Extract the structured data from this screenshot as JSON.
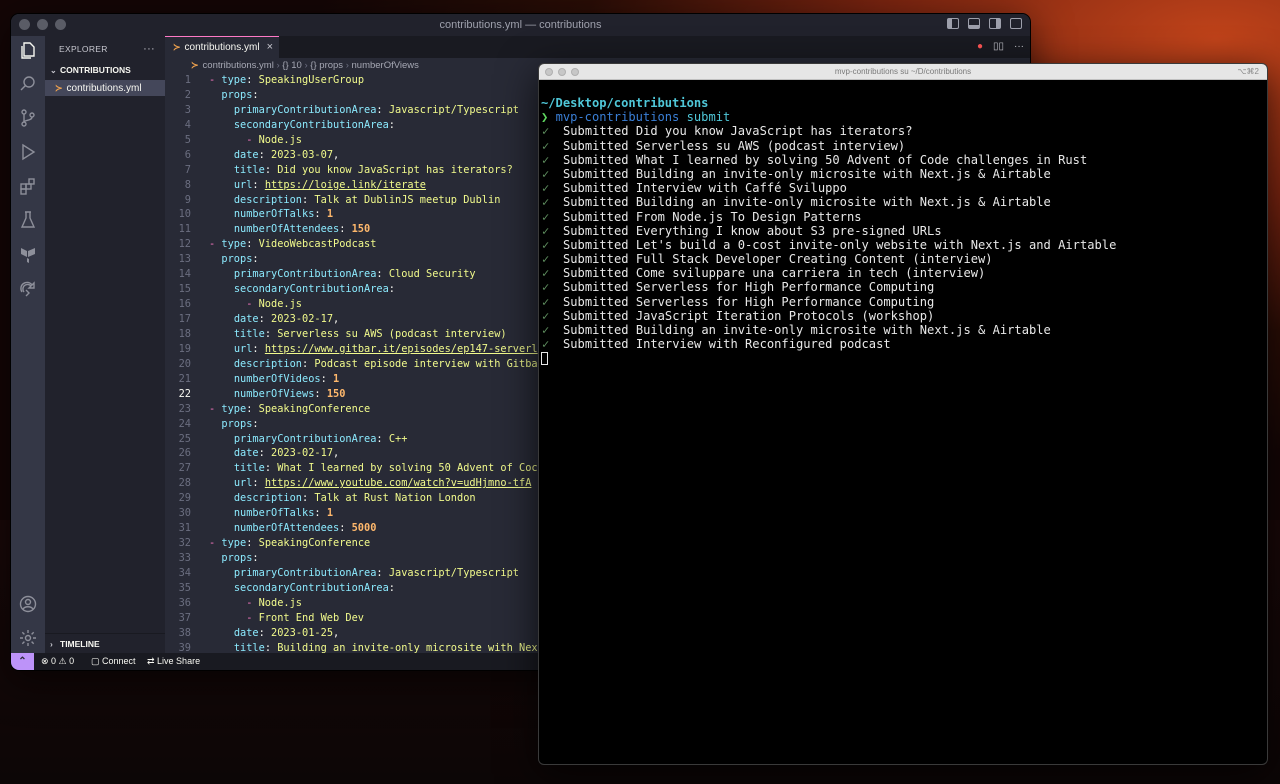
{
  "vscode": {
    "window_title": "contributions.yml — contributions",
    "sidebar": {
      "header": "EXPLORER",
      "more": "···",
      "folder": "CONTRIBUTIONS",
      "file": "contributions.yml",
      "timeline": "TIMELINE"
    },
    "tab": {
      "label": "contributions.yml",
      "close": "×"
    },
    "breadcrumb": [
      "contributions.yml",
      "{} 10",
      "{} props",
      "numberOfViews"
    ],
    "status": {
      "problems": "⊗ 0 ⚠ 0",
      "connect": "Connect",
      "live_share": "Live Share"
    },
    "activity_icons": [
      "files-icon",
      "search-icon",
      "source-control-icon",
      "run-debug-icon",
      "extensions-icon",
      "testing-icon",
      "deploy-icon",
      "remote-share-icon",
      "account-icon",
      "settings-gear-icon"
    ]
  },
  "code": [
    {
      "n": 1,
      "t": [
        [
          "p",
          "- "
        ],
        [
          "k",
          "type"
        ],
        [
          "w",
          ": "
        ],
        [
          "s",
          "SpeakingUserGroup"
        ]
      ]
    },
    {
      "n": 2,
      "t": [
        [
          "w",
          "  "
        ],
        [
          "k",
          "props"
        ],
        [
          "w",
          ":"
        ]
      ]
    },
    {
      "n": 3,
      "t": [
        [
          "w",
          "    "
        ],
        [
          "k",
          "primaryContributionArea"
        ],
        [
          "w",
          ": "
        ],
        [
          "s",
          "Javascript/Typescript"
        ]
      ]
    },
    {
      "n": 4,
      "t": [
        [
          "w",
          "    "
        ],
        [
          "k",
          "secondaryContributionArea"
        ],
        [
          "w",
          ":"
        ]
      ]
    },
    {
      "n": 5,
      "t": [
        [
          "w",
          "      "
        ],
        [
          "p",
          "- "
        ],
        [
          "s",
          "Node.js"
        ]
      ]
    },
    {
      "n": 6,
      "t": [
        [
          "w",
          "    "
        ],
        [
          "k",
          "date"
        ],
        [
          "w",
          ": "
        ],
        [
          "s",
          "2023-03-07"
        ],
        [
          "w",
          ","
        ]
      ]
    },
    {
      "n": 7,
      "t": [
        [
          "w",
          "    "
        ],
        [
          "k",
          "title"
        ],
        [
          "w",
          ": "
        ],
        [
          "s",
          "Did you know JavaScript has iterators?"
        ]
      ]
    },
    {
      "n": 8,
      "t": [
        [
          "w",
          "    "
        ],
        [
          "k",
          "url"
        ],
        [
          "w",
          ": "
        ],
        [
          "u",
          "https://loige.link/iterate"
        ]
      ]
    },
    {
      "n": 9,
      "t": [
        [
          "w",
          "    "
        ],
        [
          "k",
          "description"
        ],
        [
          "w",
          ": "
        ],
        [
          "s",
          "Talk at DublinJS meetup Dublin"
        ]
      ]
    },
    {
      "n": 10,
      "t": [
        [
          "w",
          "    "
        ],
        [
          "k",
          "numberOfTalks"
        ],
        [
          "w",
          ": "
        ],
        [
          "n",
          "1"
        ]
      ]
    },
    {
      "n": 11,
      "t": [
        [
          "w",
          "    "
        ],
        [
          "k",
          "numberOfAttendees"
        ],
        [
          "w",
          ": "
        ],
        [
          "n",
          "150"
        ]
      ]
    },
    {
      "n": 12,
      "t": [
        [
          "p",
          "- "
        ],
        [
          "k",
          "type"
        ],
        [
          "w",
          ": "
        ],
        [
          "s",
          "VideoWebcastPodcast"
        ]
      ]
    },
    {
      "n": 13,
      "t": [
        [
          "w",
          "  "
        ],
        [
          "k",
          "props"
        ],
        [
          "w",
          ":"
        ]
      ]
    },
    {
      "n": 14,
      "t": [
        [
          "w",
          "    "
        ],
        [
          "k",
          "primaryContributionArea"
        ],
        [
          "w",
          ": "
        ],
        [
          "s",
          "Cloud Security"
        ]
      ]
    },
    {
      "n": 15,
      "t": [
        [
          "w",
          "    "
        ],
        [
          "k",
          "secondaryContributionArea"
        ],
        [
          "w",
          ":"
        ]
      ]
    },
    {
      "n": 16,
      "t": [
        [
          "w",
          "      "
        ],
        [
          "p",
          "- "
        ],
        [
          "s",
          "Node.js"
        ]
      ]
    },
    {
      "n": 17,
      "t": [
        [
          "w",
          "    "
        ],
        [
          "k",
          "date"
        ],
        [
          "w",
          ": "
        ],
        [
          "s",
          "2023-02-17"
        ],
        [
          "w",
          ","
        ]
      ]
    },
    {
      "n": 18,
      "t": [
        [
          "w",
          "    "
        ],
        [
          "k",
          "title"
        ],
        [
          "w",
          ": "
        ],
        [
          "s",
          "Serverless su AWS (podcast interview)"
        ]
      ]
    },
    {
      "n": 19,
      "t": [
        [
          "w",
          "    "
        ],
        [
          "k",
          "url"
        ],
        [
          "w",
          ": "
        ],
        [
          "u",
          "https://www.gitbar.it/episodes/ep147-serverl"
        ]
      ]
    },
    {
      "n": 20,
      "t": [
        [
          "w",
          "    "
        ],
        [
          "k",
          "description"
        ],
        [
          "w",
          ": "
        ],
        [
          "s",
          "Podcast episode interview with Gitba"
        ]
      ]
    },
    {
      "n": 21,
      "t": [
        [
          "w",
          "    "
        ],
        [
          "k",
          "numberOfVideos"
        ],
        [
          "w",
          ": "
        ],
        [
          "n",
          "1"
        ]
      ]
    },
    {
      "n": 22,
      "t": [
        [
          "w",
          "    "
        ],
        [
          "k",
          "numberOfViews"
        ],
        [
          "w",
          ": "
        ],
        [
          "n",
          "150"
        ]
      ]
    },
    {
      "n": 23,
      "t": [
        [
          "p",
          "- "
        ],
        [
          "k",
          "type"
        ],
        [
          "w",
          ": "
        ],
        [
          "s",
          "SpeakingConference"
        ]
      ]
    },
    {
      "n": 24,
      "t": [
        [
          "w",
          "  "
        ],
        [
          "k",
          "props"
        ],
        [
          "w",
          ":"
        ]
      ]
    },
    {
      "n": 25,
      "t": [
        [
          "w",
          "    "
        ],
        [
          "k",
          "primaryContributionArea"
        ],
        [
          "w",
          ": "
        ],
        [
          "s",
          "C++"
        ]
      ]
    },
    {
      "n": 26,
      "t": [
        [
          "w",
          "    "
        ],
        [
          "k",
          "date"
        ],
        [
          "w",
          ": "
        ],
        [
          "s",
          "2023-02-17"
        ],
        [
          "w",
          ","
        ]
      ]
    },
    {
      "n": 27,
      "t": [
        [
          "w",
          "    "
        ],
        [
          "k",
          "title"
        ],
        [
          "w",
          ": "
        ],
        [
          "s",
          "What I learned by solving 50 Advent of Coc"
        ]
      ]
    },
    {
      "n": 28,
      "t": [
        [
          "w",
          "    "
        ],
        [
          "k",
          "url"
        ],
        [
          "w",
          ": "
        ],
        [
          "u",
          "https://www.youtube.com/watch?v=udHjmno-tfA"
        ]
      ]
    },
    {
      "n": 29,
      "t": [
        [
          "w",
          "    "
        ],
        [
          "k",
          "description"
        ],
        [
          "w",
          ": "
        ],
        [
          "s",
          "Talk at Rust Nation London"
        ]
      ]
    },
    {
      "n": 30,
      "t": [
        [
          "w",
          "    "
        ],
        [
          "k",
          "numberOfTalks"
        ],
        [
          "w",
          ": "
        ],
        [
          "n",
          "1"
        ]
      ]
    },
    {
      "n": 31,
      "t": [
        [
          "w",
          "    "
        ],
        [
          "k",
          "numberOfAttendees"
        ],
        [
          "w",
          ": "
        ],
        [
          "n",
          "5000"
        ]
      ]
    },
    {
      "n": 32,
      "t": [
        [
          "p",
          "- "
        ],
        [
          "k",
          "type"
        ],
        [
          "w",
          ": "
        ],
        [
          "s",
          "SpeakingConference"
        ]
      ]
    },
    {
      "n": 33,
      "t": [
        [
          "w",
          "  "
        ],
        [
          "k",
          "props"
        ],
        [
          "w",
          ":"
        ]
      ]
    },
    {
      "n": 34,
      "t": [
        [
          "w",
          "    "
        ],
        [
          "k",
          "primaryContributionArea"
        ],
        [
          "w",
          ": "
        ],
        [
          "s",
          "Javascript/Typescript"
        ]
      ]
    },
    {
      "n": 35,
      "t": [
        [
          "w",
          "    "
        ],
        [
          "k",
          "secondaryContributionArea"
        ],
        [
          "w",
          ":"
        ]
      ]
    },
    {
      "n": 36,
      "t": [
        [
          "w",
          "      "
        ],
        [
          "p",
          "- "
        ],
        [
          "s",
          "Node.js"
        ]
      ]
    },
    {
      "n": 37,
      "t": [
        [
          "w",
          "      "
        ],
        [
          "p",
          "- "
        ],
        [
          "s",
          "Front End Web Dev"
        ]
      ]
    },
    {
      "n": 38,
      "t": [
        [
          "w",
          "    "
        ],
        [
          "k",
          "date"
        ],
        [
          "w",
          ": "
        ],
        [
          "s",
          "2023-01-25"
        ],
        [
          "w",
          ","
        ]
      ]
    },
    {
      "n": 39,
      "t": [
        [
          "w",
          "    "
        ],
        [
          "k",
          "title"
        ],
        [
          "w",
          ": "
        ],
        [
          "s",
          "Building an invite-only microsite with Nex"
        ]
      ]
    }
  ],
  "terminal": {
    "title": "mvp-contributions su ~/D/contributions",
    "shortcut": "⌥⌘2",
    "path": "~/Desktop/contributions",
    "prompt": "❯",
    "command": "mvp-contributions",
    "argument": "submit",
    "check": "✓",
    "submitted_prefix": "Submitted",
    "submissions": [
      "Did you know JavaScript has iterators?",
      "Serverless su AWS (podcast interview)",
      "What I learned by solving 50 Advent of Code challenges in Rust",
      "Building an invite-only microsite with Next.js & Airtable",
      "Interview with Caffé Sviluppo",
      "Building an invite-only microsite with Next.js & Airtable",
      "From Node.js To Design Patterns",
      "Everything I know about S3 pre-signed URLs",
      "Let's build a 0-cost invite-only website with Next.js and Airtable",
      "Full Stack Developer Creating Content (interview)",
      "Come sviluppare una carriera in tech (interview)",
      "Serverless for High Performance Computing",
      "Serverless for High Performance Computing",
      "JavaScript Iteration Protocols (workshop)",
      "Building an invite-only microsite with Next.js & Airtable",
      "Interview with Reconfigured podcast"
    ]
  }
}
